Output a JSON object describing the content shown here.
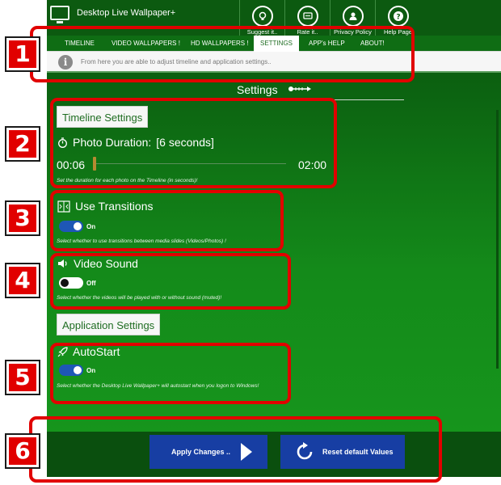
{
  "app": {
    "title": "Desktop Live Wallpaper+"
  },
  "top_actions": [
    {
      "label": "Suggest it..",
      "icon": "bulb-icon"
    },
    {
      "label": "Rate it..",
      "icon": "rate-icon"
    },
    {
      "label": "Privacy Policy",
      "icon": "user-icon"
    },
    {
      "label": "Help Page",
      "icon": "help-icon"
    }
  ],
  "tabs": [
    {
      "label": "TIMELINE"
    },
    {
      "label": "VIDEO WALLPAPERS !"
    },
    {
      "label": "HD WALLPAPERS !"
    },
    {
      "label": "SETTINGS",
      "active": true
    },
    {
      "label": "APP's HELP"
    },
    {
      "label": "ABOUT!"
    }
  ],
  "info": {
    "text": "From here you are able to adjust timeline and application settings.."
  },
  "settings": {
    "title": "Settings",
    "timeline_section": "Timeline Settings",
    "photo_duration": {
      "label": "Photo Duration:",
      "value": "[6 seconds]",
      "current": "00:06",
      "max": "02:00",
      "hint": "Set the duration for each photo on the Timeline (in seconds)!"
    },
    "use_transitions": {
      "label": "Use Transitions",
      "state": "On",
      "hint": "Select whether to use transitions between media slides (Videos/Photos) !"
    },
    "video_sound": {
      "label": "Video Sound",
      "state": "Off",
      "hint": "Select whether the videos will be played with or without sound (muted)!"
    },
    "application_section": "Application Settings",
    "autostart": {
      "label": "AutoStart",
      "state": "On",
      "hint": "Select whether the Desktop Live Wallpaper+ will autostart when you logon to Windows!"
    }
  },
  "buttons": {
    "apply": "Apply Changes ..",
    "reset": "Reset default Values"
  },
  "annotations": [
    "1",
    "2",
    "3",
    "4",
    "5",
    "6"
  ],
  "colors": {
    "accent_green": "#0f6d14",
    "annotation_red": "#e10000",
    "button_blue": "#173ea3",
    "toggle_on": "#1e57b6"
  }
}
